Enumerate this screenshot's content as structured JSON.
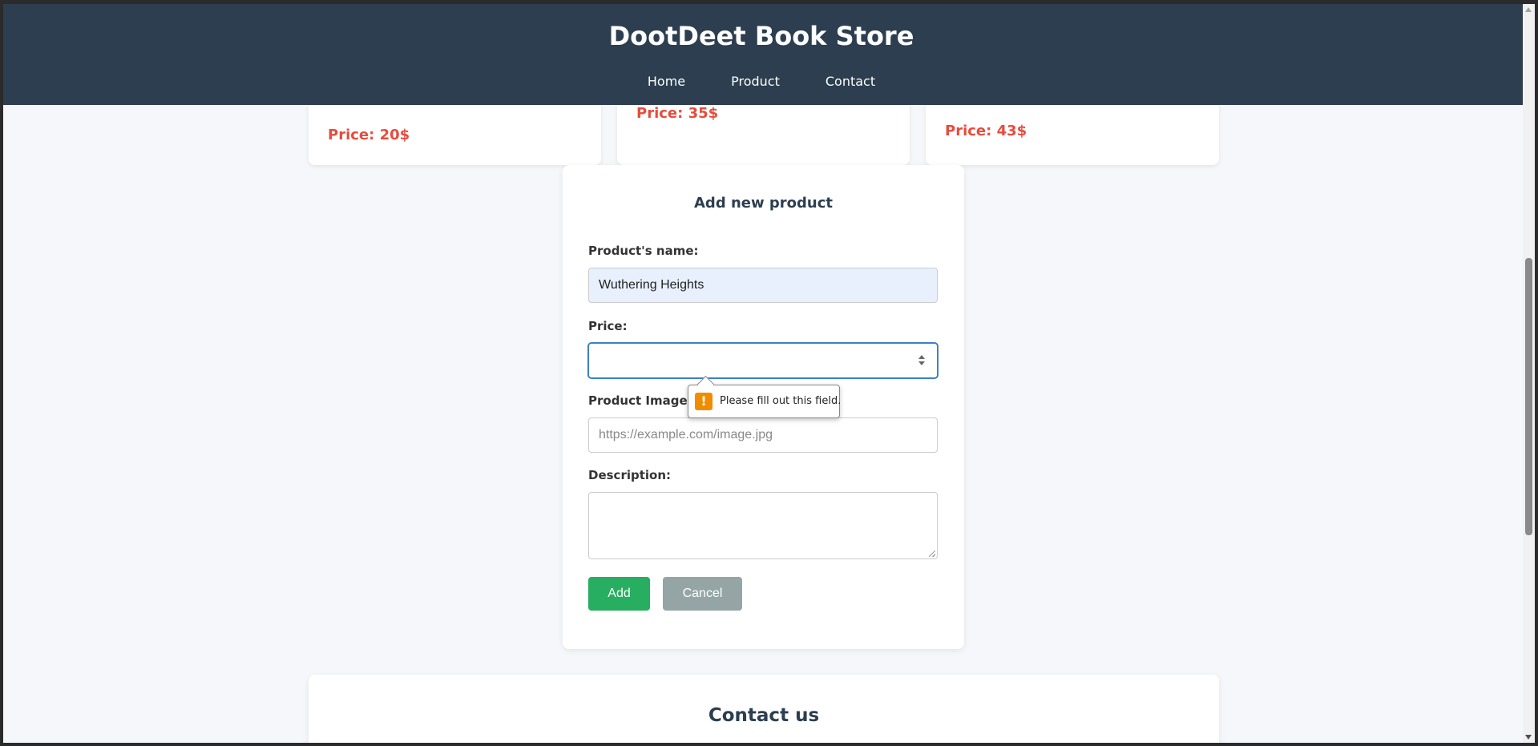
{
  "header": {
    "title": "DootDeet Book Store",
    "nav": [
      "Home",
      "Product",
      "Contact"
    ]
  },
  "products": [
    {
      "price": "Price: 20$"
    },
    {
      "price": "Price: 35$"
    },
    {
      "price": "Price: 43$"
    }
  ],
  "form": {
    "title": "Add new product",
    "name_label": "Product's name:",
    "name_value": "Wuthering Heights",
    "price_label": "Price:",
    "price_value": "",
    "image_label": "Product Image (URL):",
    "image_placeholder": "https://example.com/image.jpg",
    "description_label": "Description:",
    "add_label": "Add",
    "cancel_label": "Cancel"
  },
  "validation": {
    "icon": "warning-icon",
    "message": "Please fill out this field."
  },
  "contact": {
    "title": "Contact us"
  },
  "colors": {
    "header_bg": "#2c3e50",
    "price": "#e74c3c",
    "add_button": "#27ae60",
    "cancel_button": "#95a5a6",
    "page_bg": "#f5f7fa"
  }
}
